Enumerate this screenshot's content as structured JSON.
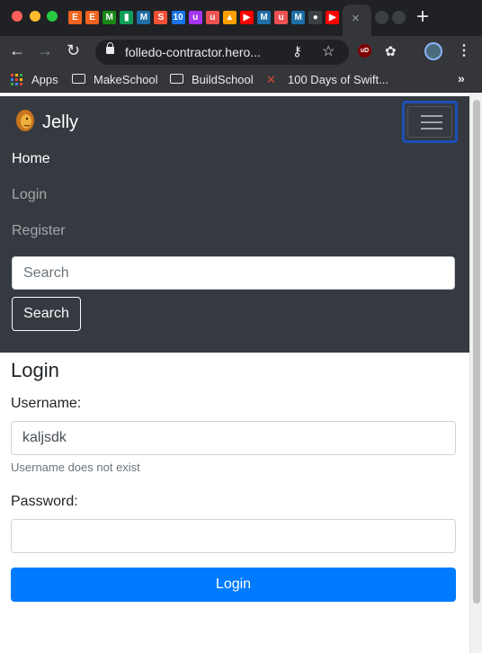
{
  "browser": {
    "url": "folledo-contractor.hero...",
    "new_tab_label": "+",
    "tab_close_label": "×",
    "favicons": [
      {
        "icon": "etsy-icon",
        "glyph": "E",
        "color": "#f1641e"
      },
      {
        "icon": "etsy-icon",
        "glyph": "E",
        "color": "#f1641e"
      },
      {
        "icon": "medium-icon",
        "glyph": "M",
        "color": "#1a8917"
      },
      {
        "icon": "chart-icon",
        "glyph": "▮",
        "color": "#0f9d58"
      },
      {
        "icon": "medium-icon",
        "glyph": "M",
        "color": "#1e6ea7"
      },
      {
        "icon": "swift-icon",
        "glyph": "S",
        "color": "#f05138"
      },
      {
        "icon": "calendar-icon",
        "glyph": "10",
        "color": "#1a73e8"
      },
      {
        "icon": "udemy-icon",
        "glyph": "u",
        "color": "#a435f0"
      },
      {
        "icon": "udemy-icon",
        "glyph": "u",
        "color": "#ec5252"
      },
      {
        "icon": "firebase-icon",
        "glyph": "▲",
        "color": "#ffa000"
      },
      {
        "icon": "youtube-icon",
        "glyph": "▶",
        "color": "#ff0000"
      },
      {
        "icon": "medium-icon",
        "glyph": "M",
        "color": "#1e6ea7"
      },
      {
        "icon": "udemy-icon",
        "glyph": "u",
        "color": "#ec5252"
      },
      {
        "icon": "medium-icon",
        "glyph": "M",
        "color": "#1e6ea7"
      },
      {
        "icon": "github-icon",
        "glyph": "●",
        "color": "#3c4043"
      },
      {
        "icon": "youtube-icon",
        "glyph": "▶",
        "color": "#ff0000"
      }
    ],
    "bookmarks": [
      {
        "label": "Apps",
        "icon": "apps-grid-icon"
      },
      {
        "label": "MakeSchool",
        "icon": "folder-icon"
      },
      {
        "label": "BuildSchool",
        "icon": "folder-icon"
      },
      {
        "label": "100 Days of Swift...",
        "icon": "swift-icon"
      }
    ],
    "bookmarks_more": "»"
  },
  "navbar": {
    "brand": "Jelly",
    "links": [
      {
        "label": "Home",
        "active": true
      },
      {
        "label": "Login",
        "active": false
      },
      {
        "label": "Register",
        "active": false
      }
    ],
    "search_placeholder": "Search",
    "search_button": "Search"
  },
  "form": {
    "title": "Login",
    "username_label": "Username:",
    "username_value": "kaljsdk",
    "username_help": "Username does not exist",
    "password_label": "Password:",
    "password_value": "",
    "submit_label": "Login"
  },
  "colors": {
    "navbar_bg": "#343a40",
    "primary": "#007bff",
    "toggler_focus": "#1c4fb8"
  }
}
